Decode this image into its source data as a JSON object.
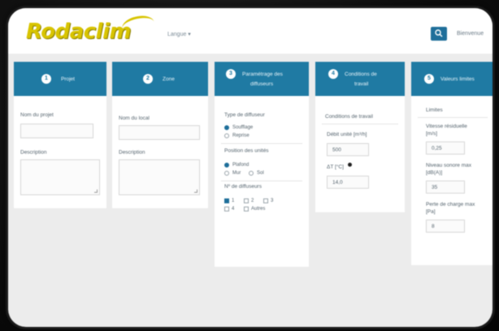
{
  "header": {
    "logo": "Rodaclim",
    "language": "Langue ▾",
    "user": "Bienvenue"
  },
  "steps": [
    {
      "number": "1",
      "label": "Projet",
      "fields": {
        "name_label": "Nom du projet",
        "description_label": "Description"
      }
    },
    {
      "number": "2",
      "label": "Zone",
      "fields": {
        "name_label": "Nom du local",
        "description_label": "Description"
      }
    },
    {
      "number": "3",
      "label_line1": "Paramétrage des",
      "label_line2": "diffuseurs",
      "type_label": "Type de diffuseur",
      "type_options": [
        "Soufflage",
        "Reprise"
      ],
      "position_label": "Position des unités",
      "position_options": [
        "Plafond",
        "Mur",
        "Sol"
      ],
      "count_label": "Nº de diffuseurs",
      "count_options": [
        "1",
        "2",
        "3",
        "4",
        "Autres"
      ]
    },
    {
      "number": "4",
      "label_line1": "Conditions de",
      "label_line2": "travail",
      "section_label": "Conditions de travail",
      "flow_label": "Débit unité [m³/h]",
      "flow_value": "500",
      "dt_label": "ΔT [°C]",
      "dt_value": "14,0"
    },
    {
      "number": "5",
      "label": "Valeurs limites",
      "section_label": "Limites",
      "speed_label_1": "Vitesse résiduelle",
      "speed_label_2": "[m/s]",
      "speed_value": "0,25",
      "noise_label_1": "Niveau sonore max",
      "noise_label_2": "[dB(A)]",
      "noise_value": "35",
      "pressure_label_1": "Perte de charge max",
      "pressure_label_2": "[Pa]",
      "pressure_value": "8"
    }
  ],
  "colors": {
    "accent": "#1f7aa3",
    "logo": "#d8c400",
    "background": "#ececec"
  }
}
